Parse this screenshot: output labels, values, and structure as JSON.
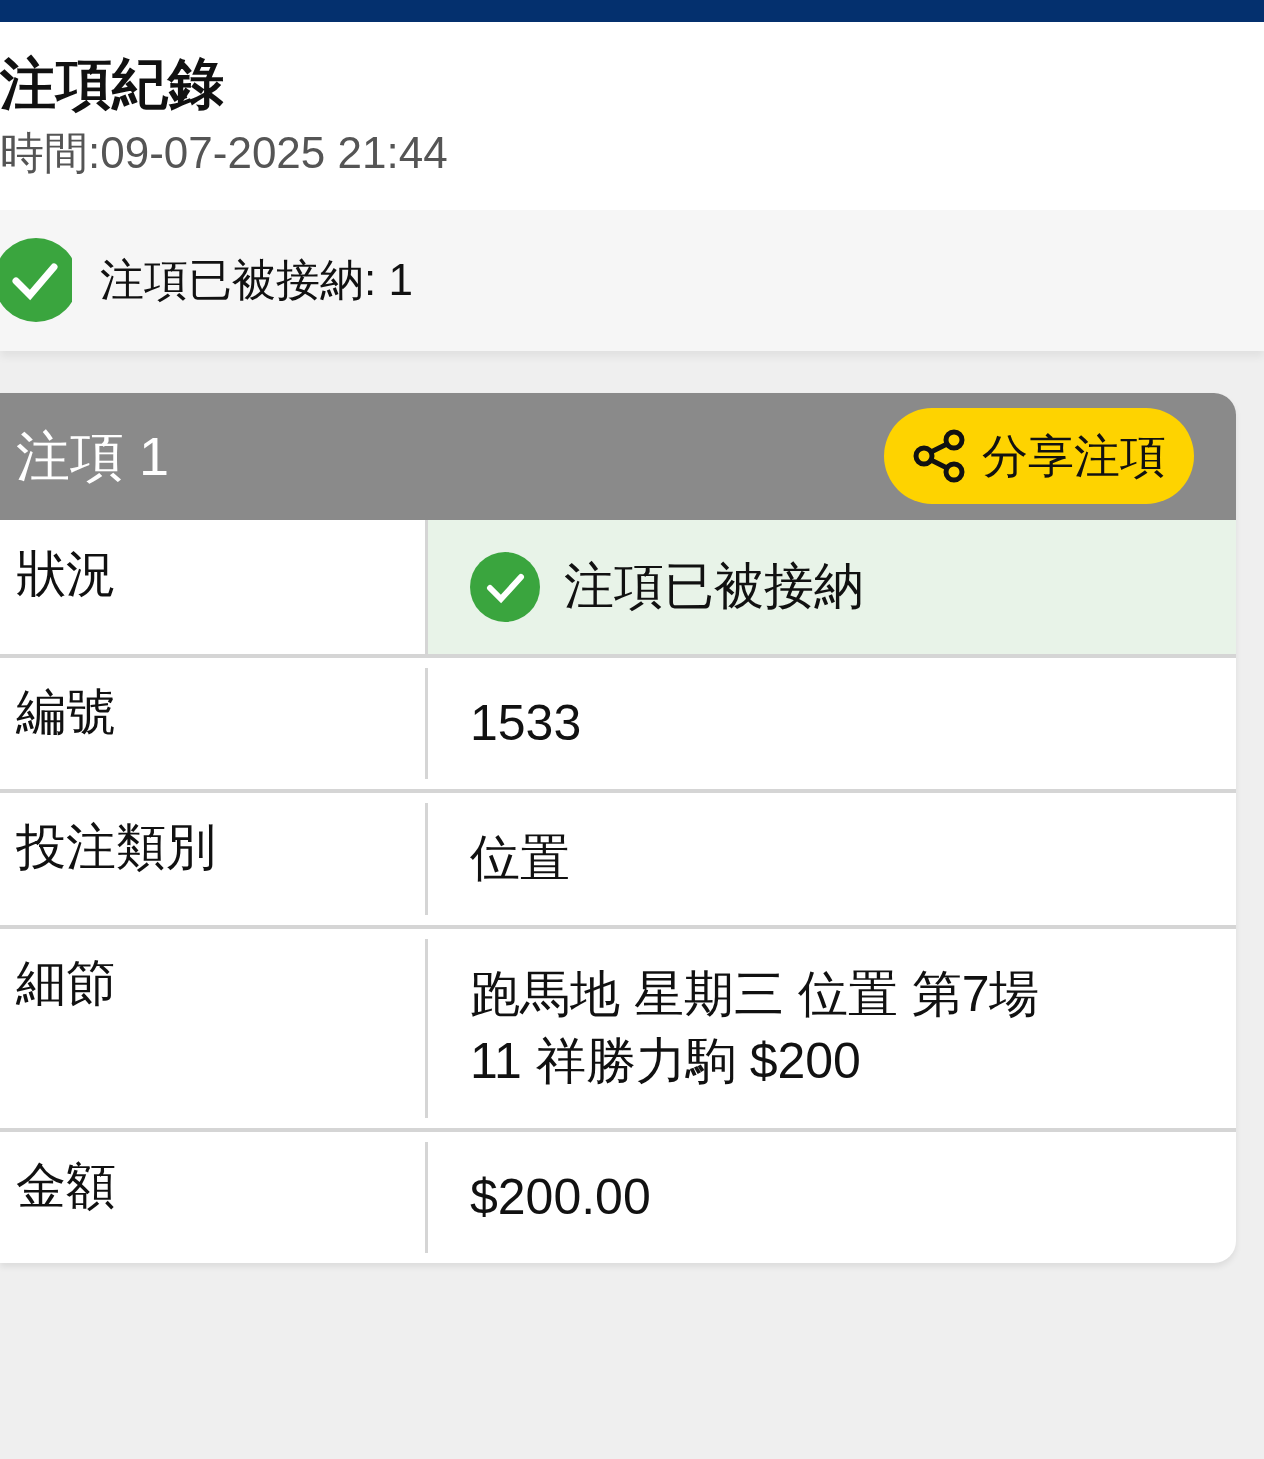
{
  "header": {
    "title": "注項紀錄",
    "time": "時間:09-07-2025 21:44"
  },
  "summary": {
    "text": "注項已被接納: 1"
  },
  "bet": {
    "title": "注項 1",
    "share_button": "分享注項",
    "rows": [
      {
        "kind": "status",
        "label": "狀況",
        "lines": [
          "注項已被接納"
        ]
      },
      {
        "kind": "text",
        "label": "編號",
        "lines": [
          "1533"
        ]
      },
      {
        "kind": "text",
        "label": "投注類別",
        "lines": [
          "位置"
        ]
      },
      {
        "kind": "text",
        "label": "細節",
        "lines": [
          "跑馬地 星期三 位置 第7場",
          "11 祥勝力駒 $200"
        ]
      },
      {
        "kind": "text",
        "label": "金額",
        "lines": [
          "$200.00"
        ]
      }
    ]
  }
}
